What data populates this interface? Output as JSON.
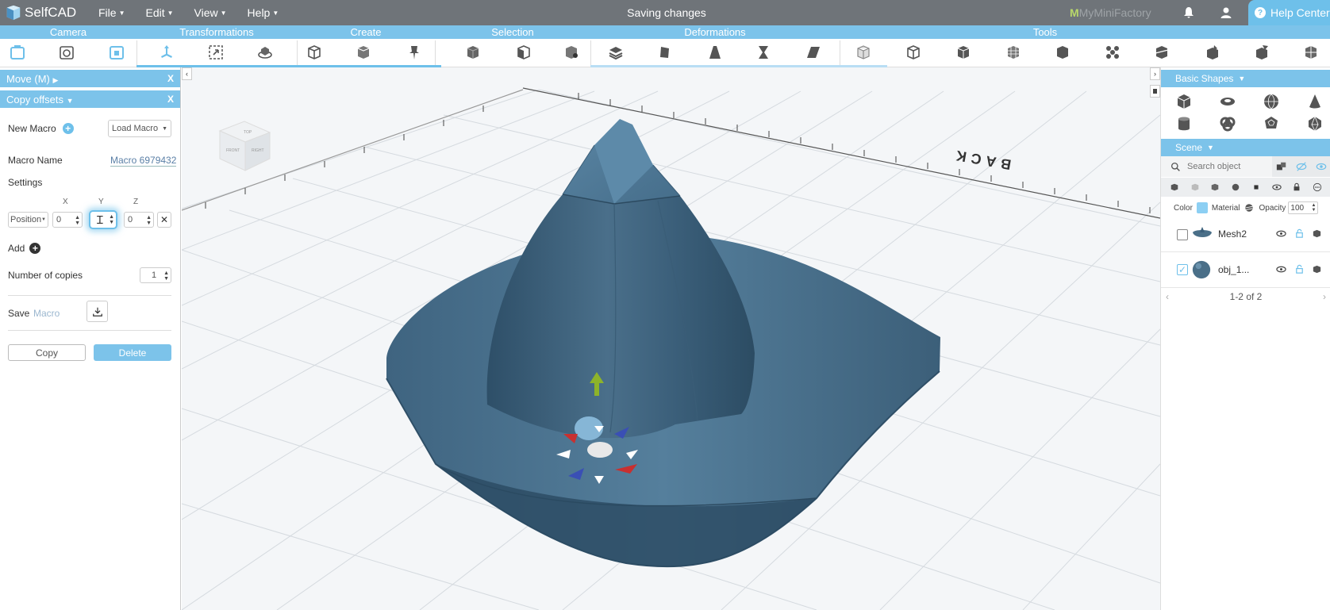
{
  "app": {
    "name": "SelfCAD",
    "status": "Saving changes",
    "partner": {
      "prefix": "M",
      "name": "MyMiniFactory"
    },
    "help_label": "Help Center"
  },
  "menus": [
    "File",
    "Edit",
    "View",
    "Help"
  ],
  "categories": [
    "Camera",
    "Transformations",
    "Create",
    "Selection",
    "Deformations",
    "Tools"
  ],
  "colors": {
    "accent": "#7cc3ea",
    "menubar": "#6f7479",
    "model": "#4a6f88",
    "delete": "#6ec0ea"
  },
  "move_panel": {
    "title": "Move (M)",
    "close": "X"
  },
  "copy_panel": {
    "title": "Copy offsets",
    "close": "X",
    "new_macro": "New Macro",
    "load_macro": "Load Macro",
    "macro_name_label": "Macro Name",
    "macro_name_value": "Macro 6979432",
    "settings": "Settings",
    "axes": [
      "X",
      "Y",
      "Z"
    ],
    "position_select": "Position",
    "x_val": "0",
    "y_val": "",
    "z_val": "0",
    "add": "Add",
    "copies_label": "Number of copies",
    "copies_val": "1",
    "save_label": "Save",
    "save_macro": "Macro",
    "copy_btn": "Copy",
    "delete_btn": "Delete"
  },
  "viewport": {
    "back_label": "BACK",
    "viewcube_faces": [
      "TOP",
      "FRONT",
      "RIGHT"
    ]
  },
  "right": {
    "basic_shapes": "Basic Shapes",
    "scene": "Scene",
    "search_placeholder": "Search object",
    "color_label": "Color",
    "material_label": "Material",
    "opacity_label": "Opacity",
    "opacity_val": "100",
    "objects": [
      {
        "name": "Mesh2",
        "checked": false
      },
      {
        "name": "obj_1...",
        "checked": true
      }
    ],
    "pagination": "1-2 of 2"
  }
}
